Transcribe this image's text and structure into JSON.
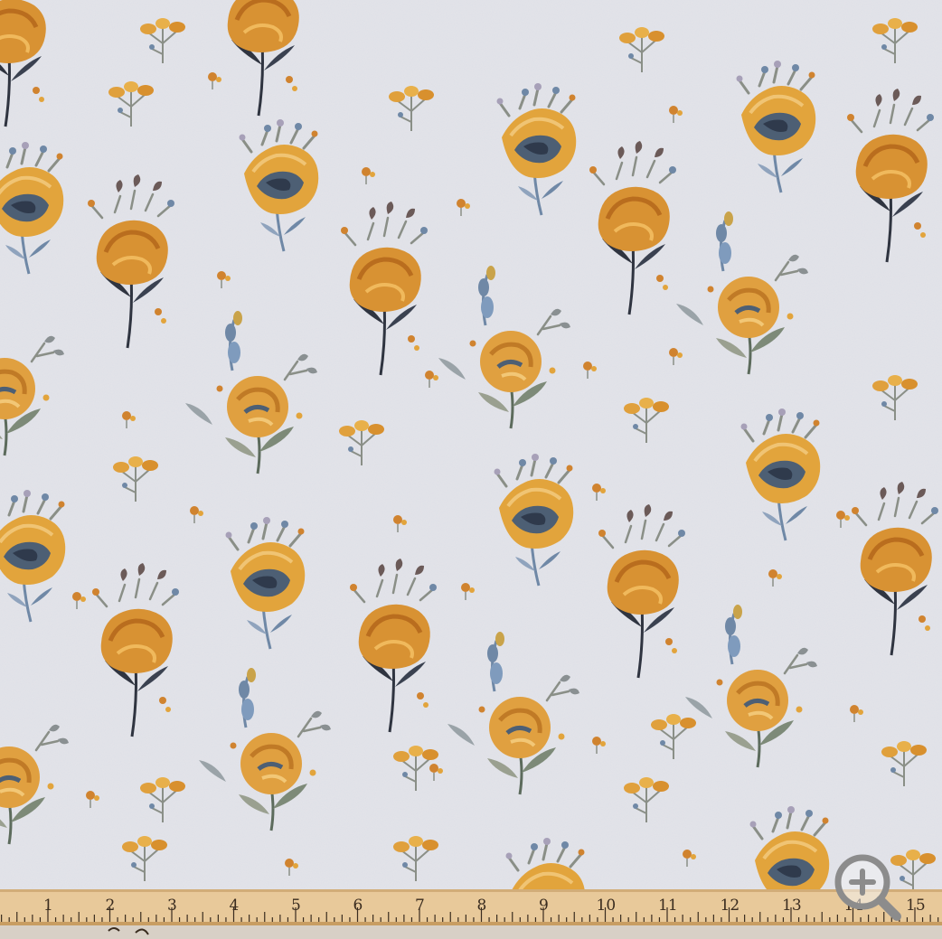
{
  "colors": {
    "background": "#e3e4ea",
    "flower_gold": "#e2a43c",
    "flower_orange": "#d0832f",
    "flower_center": "#4d5f74",
    "leaf_blue": "#6f88a6",
    "leaf_gray": "#8a8f87",
    "stem_dark": "#2f3440",
    "lavender": "#a7a0b8",
    "ruler_wood": "#e8c99a",
    "ruler_ink": "#3a2c1f"
  },
  "ruler": {
    "labels": [
      "1",
      "2",
      "3",
      "4",
      "5",
      "6",
      "7",
      "8",
      "9",
      "10",
      "11",
      "12",
      "13",
      "14",
      "15"
    ]
  },
  "icons": {
    "zoom": "zoom-in-magnifier-icon"
  }
}
